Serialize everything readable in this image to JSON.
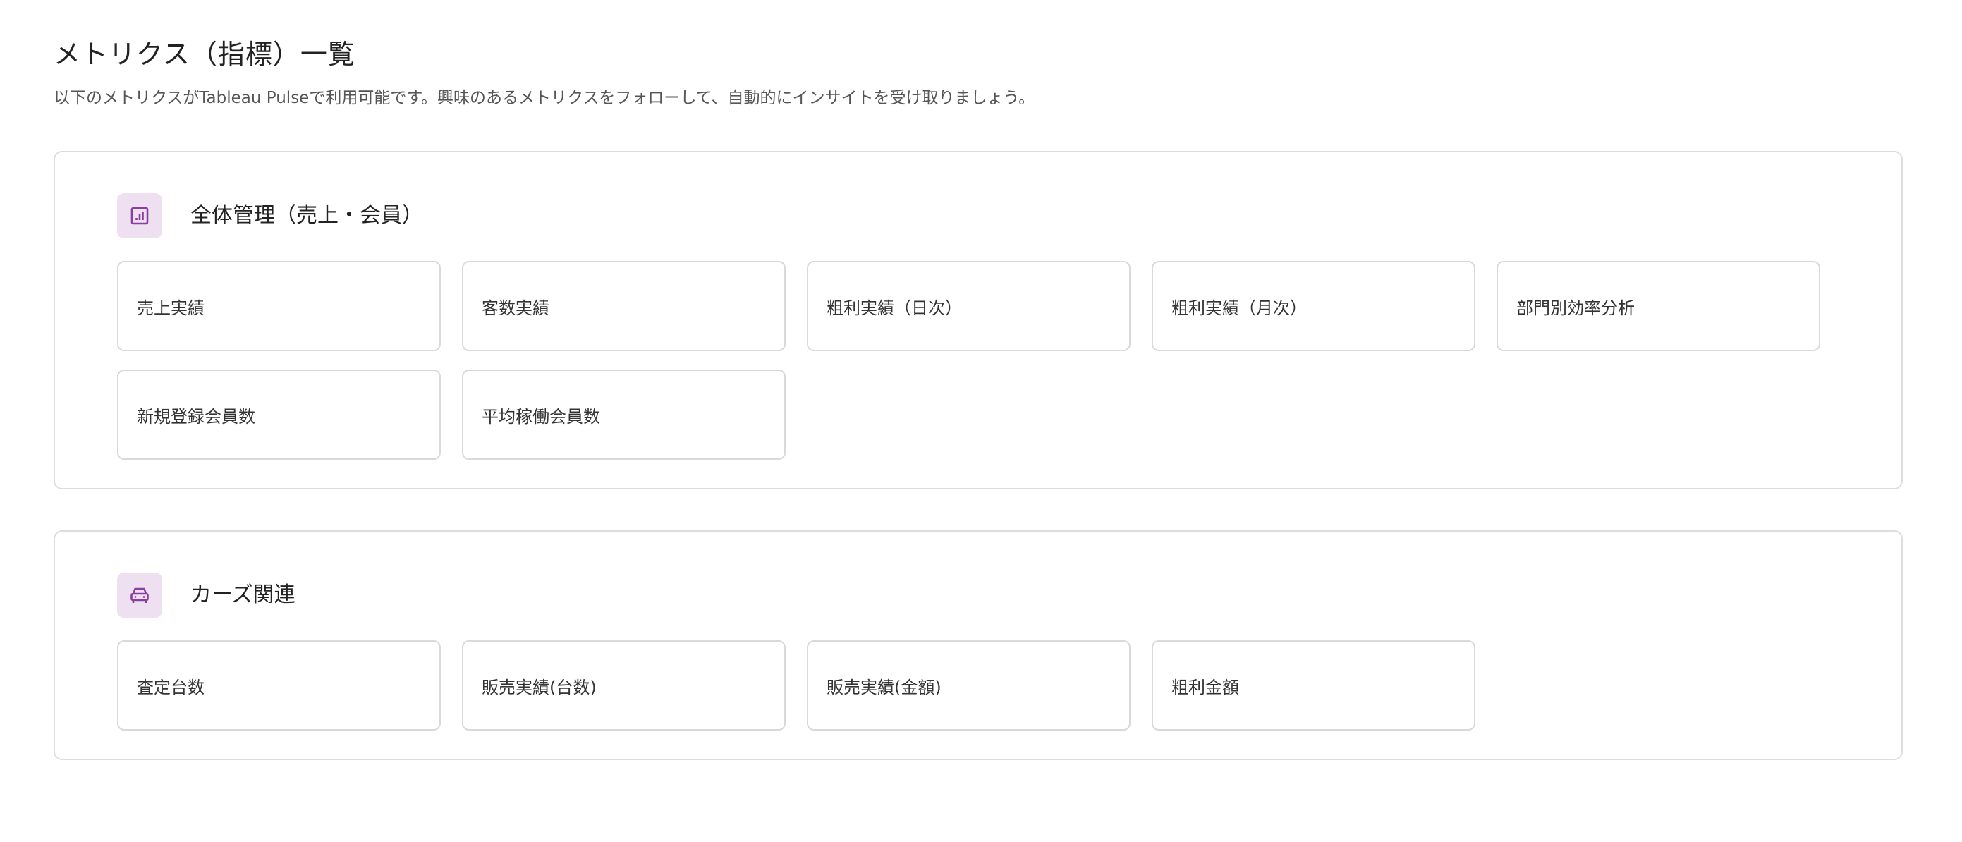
{
  "page": {
    "title": "メトリクス（指標）一覧",
    "description": "以下のメトリクスがTableau Pulseで利用可能です。興味のあるメトリクスをフォローして、自動的にインサイトを受け取りましょう。"
  },
  "colors": {
    "icon_background": "#eee0f1",
    "icon_stroke": "#8a3fa0",
    "border": "#dddddd"
  },
  "sections": [
    {
      "icon": "bar-chart-icon",
      "title": "全体管理（売上・会員）",
      "metrics": [
        "売上実績",
        "客数実績",
        "粗利実績（日次）",
        "粗利実績（月次）",
        "部門別効率分析",
        "新規登録会員数",
        "平均稼働会員数"
      ]
    },
    {
      "icon": "car-icon",
      "title": "カーズ関連",
      "metrics": [
        "査定台数",
        "販売実績(台数)",
        "販売実績(金額)",
        "粗利金額"
      ]
    }
  ]
}
